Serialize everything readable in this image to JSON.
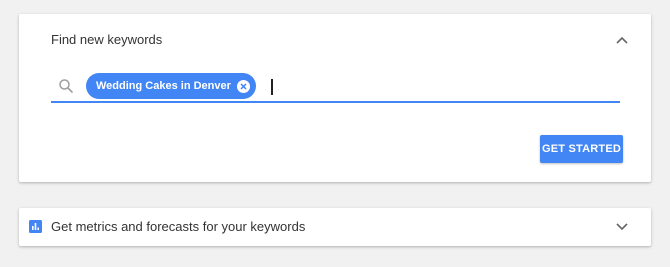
{
  "find_card": {
    "title": "Find new keywords",
    "collapse_icon": "chevron-up-icon",
    "search": {
      "icon": "search-icon",
      "chips": [
        {
          "label": "Wedding Cakes in Denver",
          "remove_icon": "close-circle-icon"
        }
      ],
      "value": ""
    },
    "button_label": "GET STARTED"
  },
  "metrics_card": {
    "icon": "bar-chart-icon",
    "title": "Get metrics and forecasts for your keywords",
    "expand_icon": "chevron-down-icon"
  },
  "colors": {
    "accent": "#4285f4",
    "page_background": "#f1f1f1",
    "card_background": "#ffffff",
    "text": "#333333"
  }
}
